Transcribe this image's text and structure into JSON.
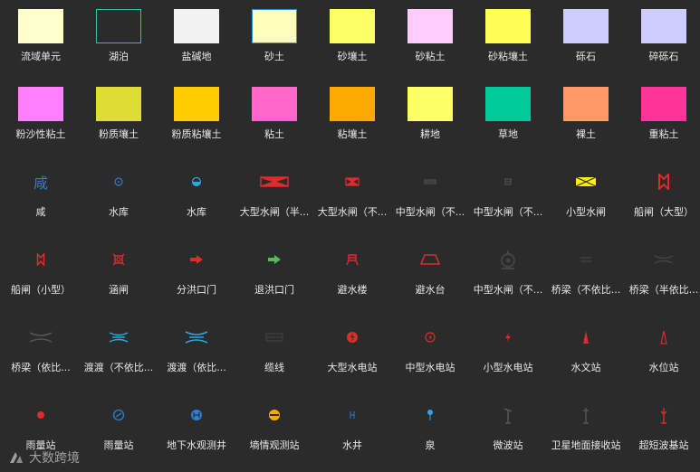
{
  "rows": [
    [
      {
        "label": "流域单元",
        "type": "swatch",
        "color": "#ffffcc"
      },
      {
        "label": "湖泊",
        "type": "swatch",
        "color": "#2b2b2c",
        "border": "#22c1c3"
      },
      {
        "label": "盐碱地",
        "type": "swatch",
        "color": "#f2f2f2"
      },
      {
        "label": "砂土",
        "type": "swatch",
        "color": "#ffffbb",
        "border": "#3a8fd6"
      },
      {
        "label": "砂壤土",
        "type": "swatch",
        "color": "#ffff66"
      },
      {
        "label": "砂粘土",
        "type": "swatch",
        "color": "#ffccff"
      },
      {
        "label": "砂粘壤土",
        "type": "swatch",
        "color": "#ffff55"
      },
      {
        "label": "砾石",
        "type": "swatch",
        "color": "#ccccff"
      },
      {
        "label": "碎砾石",
        "type": "swatch",
        "color": "#ccccff"
      }
    ],
    [
      {
        "label": "粉沙性粘土",
        "type": "swatch",
        "color": "#ff80ff"
      },
      {
        "label": "粉质壤土",
        "type": "swatch",
        "color": "#dddd33"
      },
      {
        "label": "粉质粘壤土",
        "type": "swatch",
        "color": "#ffcc00"
      },
      {
        "label": "粘土",
        "type": "swatch",
        "color": "#ff66cc"
      },
      {
        "label": "粘壤土",
        "type": "swatch",
        "color": "#ffaa00"
      },
      {
        "label": "耕地",
        "type": "swatch",
        "color": "#ffff66"
      },
      {
        "label": "草地",
        "type": "swatch",
        "color": "#00cc99"
      },
      {
        "label": "裸土",
        "type": "swatch",
        "color": "#ff9966"
      },
      {
        "label": "重粘土",
        "type": "swatch",
        "color": "#ff3399"
      }
    ],
    [
      {
        "label": "咸",
        "type": "icon",
        "icon": "xian-char-icon",
        "glyph": "咸",
        "color": "#3a78c9"
      },
      {
        "label": "水库",
        "type": "icon",
        "icon": "reservoir-small-icon",
        "color": "#3a78c9"
      },
      {
        "label": "水库",
        "type": "icon",
        "icon": "reservoir-half-icon",
        "color": "#2aa7e6"
      },
      {
        "label": "大型水闸（半...",
        "type": "icon",
        "icon": "large-sluice-half-icon",
        "color": "#e02b2b"
      },
      {
        "label": "大型水闸（不...",
        "type": "icon",
        "icon": "large-sluice-not-icon",
        "color": "#e02b2b"
      },
      {
        "label": "中型水闸（不...",
        "type": "icon",
        "icon": "medium-sluice-dark-icon",
        "color": "#555555"
      },
      {
        "label": "中型水闸（不...",
        "type": "icon",
        "icon": "medium-sluice-dark2-icon",
        "color": "#555555"
      },
      {
        "label": "小型水闸",
        "type": "icon",
        "icon": "small-sluice-icon",
        "color": "#ffee00"
      },
      {
        "label": "船闸（大型）",
        "type": "icon",
        "icon": "ship-lock-large-icon",
        "color": "#e02b2b"
      }
    ],
    [
      {
        "label": "船闸（小型）",
        "type": "icon",
        "icon": "ship-lock-small-icon",
        "color": "#e02b2b"
      },
      {
        "label": "涵闸",
        "type": "icon",
        "icon": "culvert-gate-icon",
        "color": "#e02b2b"
      },
      {
        "label": "分洪口门",
        "type": "icon",
        "icon": "flood-diversion-arrow-icon",
        "color": "#e02b2b"
      },
      {
        "label": "退洪口门",
        "type": "icon",
        "icon": "flood-return-arrow-icon",
        "color": "#55bb55"
      },
      {
        "label": "避水楼",
        "type": "icon",
        "icon": "refuge-building-icon",
        "color": "#e02b2b"
      },
      {
        "label": "避水台",
        "type": "icon",
        "icon": "refuge-platform-icon",
        "color": "#e02b2b"
      },
      {
        "label": "中型水闸（不...",
        "type": "icon",
        "icon": "medium-sluice-circle-icon",
        "color": "#444444"
      },
      {
        "label": "桥梁（不依比...",
        "type": "icon",
        "icon": "bridge-not-scaled-icon",
        "color": "#444444"
      },
      {
        "label": "桥梁（半依比...",
        "type": "icon",
        "icon": "bridge-half-scaled-icon",
        "color": "#444444"
      }
    ],
    [
      {
        "label": "桥梁（依比...",
        "type": "icon",
        "icon": "bridge-scaled-icon",
        "color": "#555555"
      },
      {
        "label": "渡渡（不依比...",
        "type": "icon",
        "icon": "ferry-not-scaled-icon",
        "color": "#2aa7e6"
      },
      {
        "label": "渡渡（依比...",
        "type": "icon",
        "icon": "ferry-scaled-icon",
        "color": "#2aa7e6"
      },
      {
        "label": "缆线",
        "type": "icon",
        "icon": "cable-line-icon",
        "color": "#444444"
      },
      {
        "label": "大型水电站",
        "type": "icon",
        "icon": "large-hydropower-icon",
        "color": "#e02b2b"
      },
      {
        "label": "中型水电站",
        "type": "icon",
        "icon": "medium-hydropower-icon",
        "color": "#e02b2b"
      },
      {
        "label": "小型水电站",
        "type": "icon",
        "icon": "small-hydropower-icon",
        "color": "#e02b2b"
      },
      {
        "label": "水文站",
        "type": "icon",
        "icon": "hydrology-station-icon",
        "color": "#e02b2b"
      },
      {
        "label": "水位站",
        "type": "icon",
        "icon": "water-level-station-icon",
        "color": "#e02b2b"
      }
    ],
    [
      {
        "label": "雨量站",
        "type": "icon",
        "icon": "rain-gauge-dot-icon",
        "color": "#e02b2b"
      },
      {
        "label": "雨量站",
        "type": "icon",
        "icon": "rain-gauge-circle-icon",
        "color": "#2a7fd6"
      },
      {
        "label": "地下水观测井",
        "type": "icon",
        "icon": "groundwater-well-icon",
        "color": "#2a7fd6"
      },
      {
        "label": "墒情观测站",
        "type": "icon",
        "icon": "soil-moisture-station-icon",
        "color": "#ffaa00"
      },
      {
        "label": "水井",
        "type": "icon",
        "icon": "water-well-icon",
        "color": "#2a7fd6"
      },
      {
        "label": "泉",
        "type": "icon",
        "icon": "spring-icon",
        "color": "#2aa7e6"
      },
      {
        "label": "微波站",
        "type": "icon",
        "icon": "microwave-station-icon",
        "color": "#555555"
      },
      {
        "label": "卫星地面接收站",
        "type": "icon",
        "icon": "satellite-ground-station-icon",
        "color": "#555555"
      },
      {
        "label": "超短波基站",
        "type": "icon",
        "icon": "ultrashort-wave-station-icon",
        "color": "#e02b2b"
      }
    ]
  ],
  "watermark": {
    "text": "大数跨境"
  }
}
